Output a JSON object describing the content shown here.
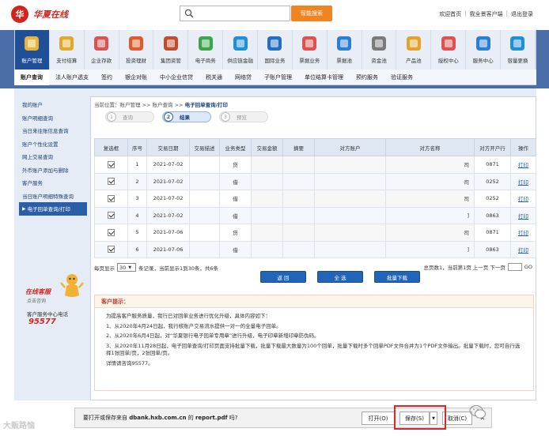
{
  "header": {
    "logo_text": "华夏在线",
    "search_button": "智能搜索",
    "top_links": [
      "欢迎首页",
      "我全景客户端",
      "退出登录"
    ]
  },
  "nav": {
    "items": [
      {
        "label": "账户管理",
        "color": "#e8b43a",
        "active": true
      },
      {
        "label": "支付结算",
        "color": "#e0a82c"
      },
      {
        "label": "企业存款",
        "color": "#d9534f"
      },
      {
        "label": "投资理财",
        "color": "#e05a2b"
      },
      {
        "label": "集团资管",
        "color": "#c24b2b"
      },
      {
        "label": "电子商务",
        "color": "#3ca64b"
      },
      {
        "label": "供应链金融",
        "color": "#1f8fd6"
      },
      {
        "label": "国际业务",
        "color": "#1f6fc2"
      },
      {
        "label": "票据业务",
        "color": "#d9534f"
      },
      {
        "label": "票据池",
        "color": "#2a7fd1"
      },
      {
        "label": "资金池",
        "color": "#7a7a7a"
      },
      {
        "label": "产品池",
        "color": "#e5a22b"
      },
      {
        "label": "授权中心",
        "color": "#d9534f"
      },
      {
        "label": "服务中心",
        "color": "#2a7fd1"
      },
      {
        "label": "容量更换",
        "color": "#1f8fd6"
      }
    ]
  },
  "subnav": {
    "items": [
      "账户查询",
      "法人账户透支",
      "签约",
      "银企对账",
      "中小企业信贷",
      "税关通",
      "网络贷",
      "子账户管理",
      "单位结算卡管理",
      "预约服务",
      "验证服务"
    ]
  },
  "sidebar": {
    "items": [
      "我的账户",
      "账户明细查询",
      "当日来往账信息查询",
      "账户个性化设置",
      "网上交易查询",
      "外币账户添加与删除",
      "客户服务",
      "当日账户明细特殊查询",
      "电子回单查询/打印"
    ],
    "active_index": 8
  },
  "help": {
    "title": "在线客服",
    "subtitle": "点击咨询",
    "phone_label": "客户服务中心电话",
    "phone": "95577"
  },
  "breadcrumb": {
    "prefix": "当前位置：账户管理 >> 账户查询 >>",
    "current": "电子回单查询/打印"
  },
  "steps": [
    {
      "num": "1",
      "label": "查询"
    },
    {
      "num": "2",
      "label": "结果",
      "active": true
    },
    {
      "num": "3",
      "label": "预览"
    }
  ],
  "table": {
    "headers": [
      "复选框",
      "序号",
      "交易日期",
      "交易描述",
      "业务类型",
      "交易金额",
      "摘要",
      "对方账户",
      "对方名称",
      "对方开户行",
      "操作"
    ],
    "rows": [
      {
        "seq": "1",
        "date": "2021-07-02",
        "type": "贷",
        "name_tail": "司",
        "bank": "0871",
        "op": "打印"
      },
      {
        "seq": "2",
        "date": "2021-07-02",
        "type": "借",
        "name_tail": "司",
        "bank": "0252",
        "op": "打印"
      },
      {
        "seq": "3",
        "date": "2021-07-02",
        "type": "借",
        "name_tail": "司",
        "bank": "0252",
        "op": "打印"
      },
      {
        "seq": "4",
        "date": "2021-07-02",
        "type": "借",
        "name_tail": "]",
        "bank": "0863",
        "op": "打印"
      },
      {
        "seq": "5",
        "date": "2021-07-06",
        "type": "贷",
        "name_tail": "司",
        "bank": "0871",
        "op": "打印"
      },
      {
        "seq": "6",
        "date": "2021-07-06",
        "type": "借",
        "name_tail": "]",
        "bank": "0863",
        "op": "打印"
      }
    ]
  },
  "pager": {
    "per_page_label": "每页显示",
    "per_page_value": "30",
    "per_page_suffix": "条记录，当前显示1到30条，共6条",
    "total": "总页数1，当前第1页 上一页 下一页",
    "go": "GO"
  },
  "actions": {
    "back": "返 回",
    "select_all": "全 选",
    "batch_download": "批量下载"
  },
  "tips": {
    "title": "客户提示：",
    "lines": [
      "为提高客户服务质量，我行已对回单业务进行优化升级，具体内容如下：",
      "1、从2020年4月24日起，我行核账户交易流水提供一对一的全量电子回单。",
      "2、从2020年6月4日起，对“华夏银行电子回单专用章”进行升级，电子印章新增印章防伪码。",
      "3、从2020年11月28日起，电子回单查询/打印页面支持批量下载，批量下载最大数量为100个回单，批量下载时多个回单PDF文件合并为1个PDF文件输出。批量下载时，您可自行选择1张回单/页，2张回单/页。",
      "详情请咨询95577。"
    ]
  },
  "download_bar": {
    "prefix": "要打开或保存来自",
    "site": "dbank.hxb.com.cn",
    "middle": "的",
    "file": "report.pdf",
    "suffix": "吗?",
    "open": "打开(O)",
    "save": "保存(S)",
    "cancel": "取消(C)"
  },
  "watermark": "大贩路恼"
}
